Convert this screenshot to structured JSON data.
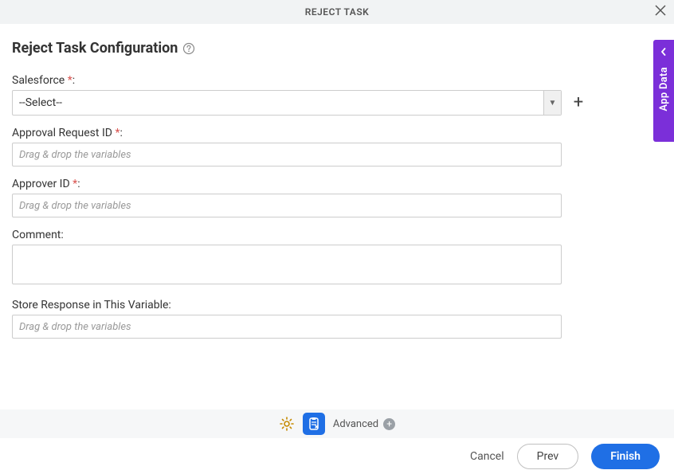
{
  "header": {
    "title": "REJECT TASK"
  },
  "page": {
    "title": "Reject Task Configuration"
  },
  "fields": {
    "salesforce": {
      "label": "Salesforce",
      "selected": "--Select--"
    },
    "approval_request": {
      "label": "Approval Request ID",
      "placeholder": "Drag & drop the variables"
    },
    "approver_id": {
      "label": "Approver ID",
      "placeholder": "Drag & drop the variables"
    },
    "comment": {
      "label": "Comment:"
    },
    "store_response": {
      "label": "Store Response in This Variable:",
      "placeholder": "Drag & drop the variables"
    }
  },
  "required_marker": "*",
  "colon": ":",
  "side_tab": {
    "label": "App Data"
  },
  "toolbar": {
    "advanced_label": "Advanced"
  },
  "footer": {
    "cancel": "Cancel",
    "prev": "Prev",
    "finish": "Finish"
  }
}
